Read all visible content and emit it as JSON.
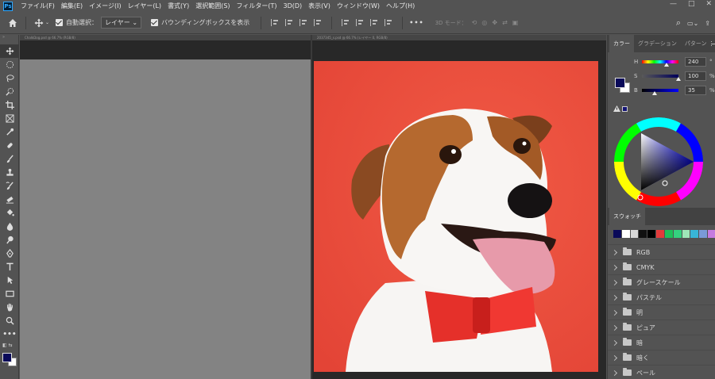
{
  "menu": {
    "logo": "Ps",
    "items": [
      "ファイル(F)",
      "編集(E)",
      "イメージ(I)",
      "レイヤー(L)",
      "書式(Y)",
      "選択範囲(S)",
      "フィルター(T)",
      "3D(D)",
      "表示(V)",
      "ウィンドウ(W)",
      "ヘルプ(H)"
    ],
    "window_controls": [
      "—",
      "□",
      "✕"
    ]
  },
  "options": {
    "auto_select_label": "自動選択：",
    "layer_select": "レイヤー",
    "bounding_box_label": "バウンディングボックスを表示",
    "more": "•••",
    "mode_3d": "3D モード："
  },
  "documents": [
    {
      "tab": "ChalkDog.psd @ 66.7% (RGB/8)"
    },
    {
      "tab": "2037345_s.psd @ 66.7% (レイヤー 0, RGB/8)"
    }
  ],
  "color_panel": {
    "tabs": [
      "カラー",
      "グラデーション",
      "パターン"
    ],
    "h_label": "H",
    "h_value": "240",
    "h_unit": "°",
    "h": 240,
    "s_label": "S",
    "s_value": "100",
    "s_unit": "%",
    "s": 100,
    "b_label": "B",
    "b_value": "35",
    "b_unit": "%",
    "b": 35,
    "foreground": "#0a0a59",
    "background": "#ffffff"
  },
  "swatches_panel": {
    "tab": "スウォッチ",
    "colors": [
      "#0a0a59",
      "#ffffff",
      "#d9d9d9",
      "#111111",
      "#000000",
      "#e23b3b",
      "#1ec05a",
      "#35d07f",
      "#9ee6b8",
      "#38b6d8",
      "#7a9ad8",
      "#c57be0"
    ],
    "folders": [
      "RGB",
      "CMYK",
      "グレースケール",
      "パステル",
      "明",
      "ピュア",
      "暗",
      "暗く",
      "ペール"
    ]
  }
}
